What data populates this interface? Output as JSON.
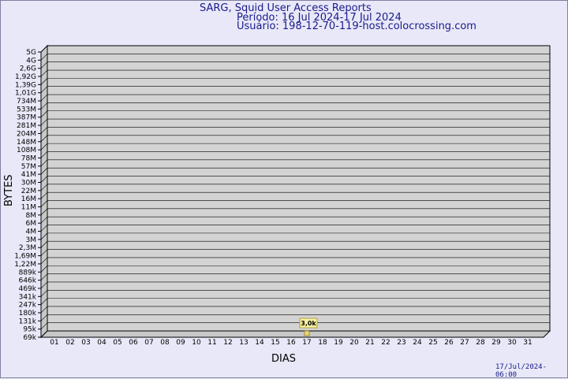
{
  "header": {
    "title": "SARG, Squid User Access Reports",
    "period": "Período: 16 Jul 2024-17 Jul 2024",
    "user": "Usuário: 198-12-70-119-host.colocrossing.com"
  },
  "footer": {
    "timestamp": "17/Jul/2024-06:00"
  },
  "colors": {
    "background": "#e8e8f8",
    "plot": "#d3d3d3",
    "header_text": "#1a1a8a",
    "callout": "#f8f0a0"
  },
  "chart_data": {
    "type": "bar",
    "xlabel": "DIAS",
    "ylabel": "BYTES",
    "categories": [
      "01",
      "02",
      "03",
      "04",
      "05",
      "06",
      "07",
      "08",
      "09",
      "10",
      "11",
      "12",
      "13",
      "14",
      "15",
      "16",
      "17",
      "18",
      "19",
      "20",
      "21",
      "22",
      "23",
      "24",
      "25",
      "26",
      "27",
      "28",
      "29",
      "30",
      "31"
    ],
    "y_ticks": [
      "5G",
      "4G",
      "2,6G",
      "1,92G",
      "1,39G",
      "1,01G",
      "734M",
      "533M",
      "387M",
      "281M",
      "204M",
      "148M",
      "108M",
      "78M",
      "57M",
      "41M",
      "30M",
      "22M",
      "16M",
      "11M",
      "8M",
      "6M",
      "4M",
      "3M",
      "2,3M",
      "1,69M",
      "1,22M",
      "889k",
      "646k",
      "469k",
      "341k",
      "247k",
      "180k",
      "131k",
      "95k",
      "69k"
    ],
    "series": [
      {
        "values": [
          0,
          0,
          0,
          0,
          0,
          0,
          0,
          0,
          0,
          0,
          0,
          0,
          0,
          0,
          0,
          0,
          3000,
          0,
          0,
          0,
          0,
          0,
          0,
          0,
          0,
          0,
          0,
          0,
          0,
          0,
          0
        ]
      }
    ],
    "data_labels": [
      {
        "category": "17",
        "text": "3,0k"
      }
    ],
    "grid": true
  }
}
